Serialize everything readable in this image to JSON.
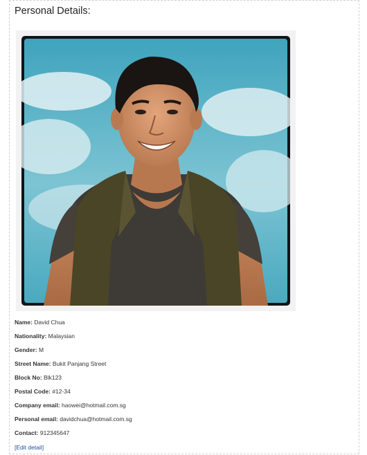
{
  "panel": {
    "title": "Personal Details:"
  },
  "photo": {
    "icon": "profile-photo",
    "colors": {
      "sky": "#5fb6c8",
      "cloud": "#dfeff2",
      "vest": "#4a4526",
      "shirt": "#3e3a36",
      "skin": "#c98c63",
      "hair": "#1a1512"
    }
  },
  "details": {
    "rows": [
      {
        "label": "Name:",
        "value": "David Chua"
      },
      {
        "label": "Nationality:",
        "value": "Malaysian"
      },
      {
        "label": "Gender:",
        "value": "M"
      },
      {
        "label": "Street Name:",
        "value": "Bukit Panjang Street"
      },
      {
        "label": "Block No:",
        "value": "Blk123"
      },
      {
        "label": "Postal Code:",
        "value": "#12-34"
      },
      {
        "label": "Company email:",
        "value": "haowei@hotmail.com.sg"
      },
      {
        "label": "Personal email:",
        "value": "davidchua@hotmail.com.sg"
      },
      {
        "label": "Contact:",
        "value": "912345647"
      }
    ],
    "edit_link": "[Edit detail]"
  }
}
